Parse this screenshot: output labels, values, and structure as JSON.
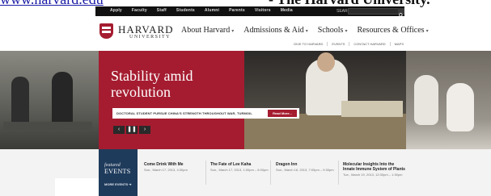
{
  "caption": {
    "link_text": "www.harvard.edu",
    "tail_text": "- The Harvard University."
  },
  "utility": {
    "links": [
      "Apply",
      "Faculty",
      "Staff",
      "Students",
      "Alumni",
      "Parents",
      "Visitors",
      "Media"
    ],
    "search_label": "SEARCH"
  },
  "brand": {
    "wordmark": "HARVARD",
    "sub": "UNIVERSITY"
  },
  "mainnav": [
    {
      "label": "About Harvard"
    },
    {
      "label": "Admissions & Aid"
    },
    {
      "label": "Schools"
    },
    {
      "label": "Resources & Offices"
    }
  ],
  "subnav": [
    "GIVE TO HARVARD",
    "EVENTS",
    "CONTACT HARVARD",
    "MAPS"
  ],
  "hero": {
    "headline": "Stability amid revolution",
    "story": "DOCTORAL STUDENT PURSUE CHINA'S STRENGTH THROUGHOUT WAR, TURMOIL",
    "read_more": "Read More...",
    "ctrl_prev": "‹",
    "ctrl_pause": "❚❚",
    "ctrl_next": "›"
  },
  "events": {
    "featured_line1": "featured",
    "featured_line2": "EVENTS",
    "more": "MORE EVENTS ➔",
    "items": [
      {
        "title": "Come Drink With Me",
        "date": "Sun., March 17, 2013, 4:30pm"
      },
      {
        "title": "The Fate of Lee Kaha",
        "date": "Sun., March 17, 2013, 1:00pm – 6:00pm"
      },
      {
        "title": "Dragon Inn",
        "date": "Sun., March 16, 2013, 7:00pm – 9:30pm"
      },
      {
        "title": "Molecular Insights Into the Innate Immune System of Plants",
        "date": "Tue., March 19, 2013, 12:30pm – 1:30pm"
      }
    ]
  }
}
